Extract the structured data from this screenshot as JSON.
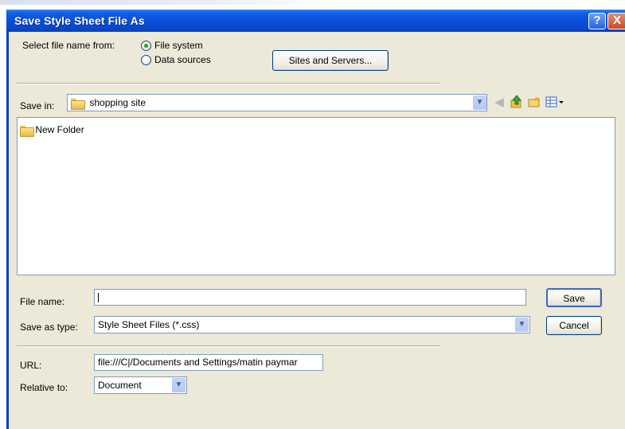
{
  "window": {
    "title": "Save Style Sheet File As",
    "help_glyph": "?",
    "close_glyph": "X"
  },
  "select_from": {
    "label": "Select file name from:",
    "options": [
      {
        "label": "File system",
        "selected": true
      },
      {
        "label": "Data sources",
        "selected": false
      }
    ],
    "sites_button": "Sites and Servers..."
  },
  "save_in": {
    "label": "Save in:",
    "value": "shopping site",
    "icons": [
      "back-icon",
      "up-folder-icon",
      "new-folder-icon",
      "view-menu-icon"
    ]
  },
  "file_list": {
    "items": [
      {
        "name": "New Folder",
        "icon": "folder-icon"
      }
    ]
  },
  "file_name": {
    "label": "File name:",
    "value": ""
  },
  "save_as_type": {
    "label": "Save as type:",
    "value": "Style Sheet Files (*.css)"
  },
  "buttons": {
    "save": "Save",
    "cancel": "Cancel"
  },
  "url": {
    "label": "URL:",
    "value": "file:///C|/Documents and Settings/matin paymar"
  },
  "relative_to": {
    "label": "Relative to:",
    "value": "Document"
  },
  "colors": {
    "titlebar": "#0a50dc",
    "dialog_bg": "#ece9d8",
    "field_border": "#7f9db9",
    "radio_dot": "#21a121"
  }
}
